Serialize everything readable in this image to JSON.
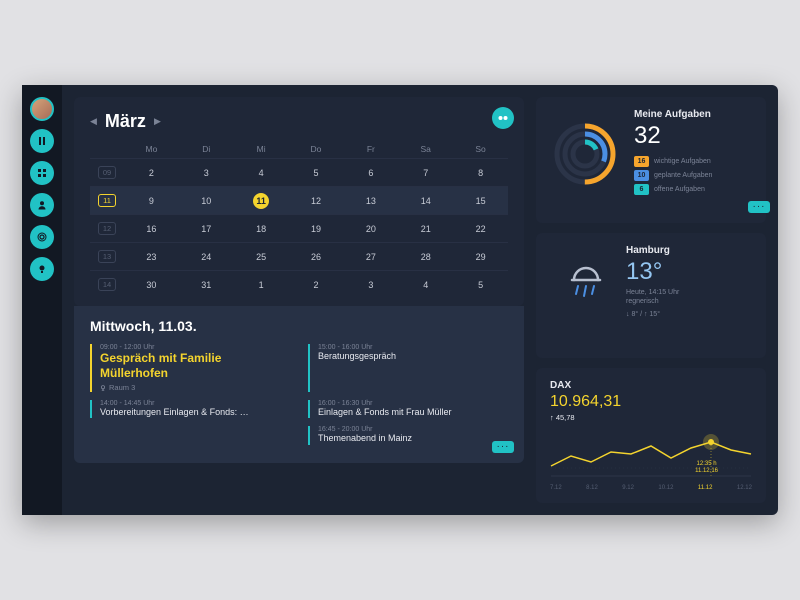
{
  "sidebar": {
    "icons": [
      "pause-icon",
      "grid-icon",
      "user-icon",
      "settings-icon",
      "bulb-icon"
    ]
  },
  "calendar": {
    "month": "März",
    "fab": "+",
    "weekdays": [
      "Mo",
      "Di",
      "Mi",
      "Do",
      "Fr",
      "Sa",
      "So"
    ],
    "weeks": [
      {
        "num": "09",
        "days": [
          "2",
          "3",
          "4",
          "5",
          "6",
          "7",
          "8"
        ]
      },
      {
        "num": "11",
        "days": [
          "9",
          "10",
          "11",
          "12",
          "13",
          "14",
          "15"
        ],
        "sel": 2,
        "highlight": true
      },
      {
        "num": "12",
        "days": [
          "16",
          "17",
          "18",
          "19",
          "20",
          "21",
          "22"
        ]
      },
      {
        "num": "13",
        "days": [
          "23",
          "24",
          "25",
          "26",
          "27",
          "28",
          "29"
        ]
      },
      {
        "num": "14",
        "days": [
          "30",
          "31",
          "1",
          "2",
          "3",
          "4",
          "5"
        ]
      }
    ]
  },
  "detail": {
    "title": "Mittwoch, 11.03.",
    "events": [
      {
        "time": "09:00 - 12:00 Uhr",
        "title": "Gespräch mit Familie Müllerhofen",
        "room": "Raum 3",
        "color": "#f4d42e",
        "big": true
      },
      {
        "time": "15:00 - 16:00 Uhr",
        "title": "Beratungsgespräch",
        "color": "#21c2c5"
      },
      {
        "time": "14:00 - 14:45 Uhr",
        "title": "Vorbereitungen Einlagen & Fonds: …",
        "color": "#21c2c5"
      },
      {
        "time": "16:00 - 16:30 Uhr",
        "title": "Einlagen & Fonds mit Frau Müller",
        "color": "#21c2c5"
      },
      {
        "time": "",
        "title": "",
        "color": "transparent"
      },
      {
        "time": "16:45 - 20:00 Uhr",
        "title": "Themenabend in Mainz",
        "color": "#21c2c5"
      }
    ],
    "more": "···"
  },
  "tasks": {
    "title": "Meine Aufgaben",
    "total": "32",
    "items": [
      {
        "count": "16",
        "label": "wichtige Aufgaben",
        "color": "#f6a52d"
      },
      {
        "count": "10",
        "label": "geplante Aufgaben",
        "color": "#4b8fe3"
      },
      {
        "count": "6",
        "label": "offene Aufgaben",
        "color": "#21c2c5"
      }
    ],
    "more": "···"
  },
  "weather": {
    "city": "Hamburg",
    "temp": "13°",
    "time": "Heute, 14:15 Uhr",
    "cond": "regnerisch",
    "hl": "↓ 8° / ↑ 15°"
  },
  "stock": {
    "name": "DAX",
    "value": "10.964,31",
    "delta": "↑ 45,78",
    "marker_time": "12:35 h",
    "marker_date": "11.12.16",
    "x": [
      "7.12",
      "8.12",
      "9.12",
      "10.12",
      "11.12",
      "12.12"
    ]
  },
  "chart_data": {
    "type": "line",
    "title": "DAX",
    "x": [
      "7.12",
      "8.12",
      "9.12",
      "10.12",
      "11.12",
      "12.12"
    ],
    "values": [
      10750,
      10810,
      10920,
      10800,
      10964,
      10900
    ],
    "highlight_index": 4,
    "ylim": [
      10700,
      11000
    ]
  }
}
